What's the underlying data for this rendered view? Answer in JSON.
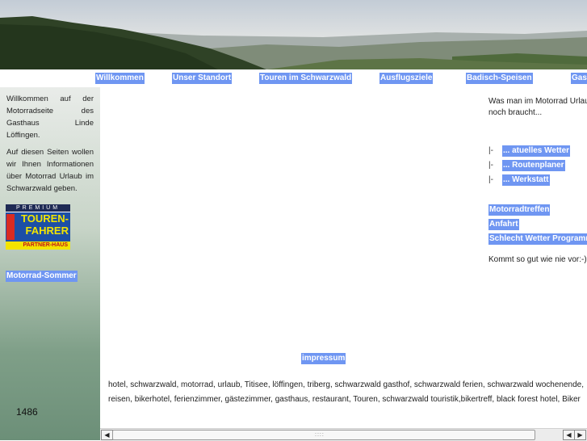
{
  "header": {
    "image_alt": "Schwarzwald landscape panorama"
  },
  "nav": {
    "items": [
      {
        "label": "Willkommen"
      },
      {
        "label": "Unser Standort"
      },
      {
        "label": "Touren im Schwarzwald"
      },
      {
        "label": "Ausflugsziele"
      },
      {
        "label": "Badisch-Speisen"
      },
      {
        "label": "Gas"
      }
    ]
  },
  "sidebar": {
    "intro": "Willkommen auf der Motorradseite des Gasthaus Linde Löffingen.",
    "intro2": "Auf diesen Seiten wollen wir Ihnen Informationen über Motorrad Urlaub im Schwarzwald geben.",
    "logo": {
      "top": "PREMIUM",
      "line1": "TOUREN-",
      "line2": "FAHRER",
      "bottom": "PARTNER-HAUS"
    },
    "link": "Motorrad-Sommer",
    "counter": "1486"
  },
  "right": {
    "intro_line1": "Was man im Motorrad Urlau",
    "intro_line2": "noch braucht...",
    "bullet": "|-",
    "links": [
      {
        "label": "... atuelles Wetter"
      },
      {
        "label": "... Routenplaner"
      },
      {
        "label": "... Werkstatt"
      }
    ],
    "links2": [
      {
        "label": "Motorradtreffen"
      },
      {
        "label": "Anfahrt"
      },
      {
        "label": "Schlecht Wetter Programm"
      }
    ],
    "outro": "Kommt so gut wie nie vor:-)"
  },
  "footer": {
    "impressum": "impressum",
    "keywords_line1": "hotel, schwarzwald, motorrad, urlaub, Titisee, löffingen, triberg, schwarzwald gasthof, schwarzwald ferien, schwarzwald wochenende,",
    "keywords_line2": "reisen, bikerhotel, ferienzimmer, gästezimmer, gasthaus, restaurant, Touren, schwarzwald touristik,bikertreff, black forest hotel, Biker"
  },
  "scrollbar": {
    "left_arrow": "◀",
    "right_arrow_left": "◀",
    "right_arrow_right": "▶",
    "grip": "::::"
  },
  "colors": {
    "link_bg": "#6f96f2",
    "sidebar_bottom": "#6c8f78"
  }
}
